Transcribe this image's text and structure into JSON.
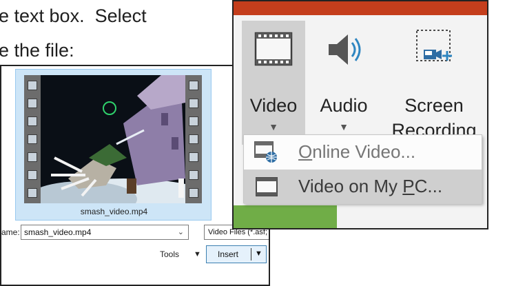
{
  "document": {
    "line1": "e text box.  Select",
    "line2": "e the file:"
  },
  "file_dialog": {
    "thumbnail_filename": "smash_video.mp4",
    "file_name_label": "ame:",
    "file_name_value": "smash_video.mp4",
    "file_type_filter": "Video Files (*.asf;",
    "tools_label": "Tools",
    "insert_label": "Insert"
  },
  "ribbon": {
    "buttons": [
      {
        "label": "Video",
        "icon": "film-strip-icon"
      },
      {
        "label": "Audio",
        "icon": "speaker-icon"
      },
      {
        "label_line1": "Screen",
        "label_line2": "Recording",
        "icon": "screen-recording-icon"
      }
    ],
    "menu": {
      "items": [
        {
          "prefix": "",
          "accel": "O",
          "suffix": "nline Video...",
          "icon": "online-video-icon",
          "state": "disabled"
        },
        {
          "prefix": "Video on My ",
          "accel": "P",
          "suffix": "C...",
          "icon": "video-file-icon",
          "state": "hover"
        }
      ]
    },
    "colors": {
      "tab_bar": "#c43e1c",
      "selected_button": "#d0d0d0",
      "menu_hover": "#cfcfcf",
      "accent_green": "#70ad47"
    }
  }
}
